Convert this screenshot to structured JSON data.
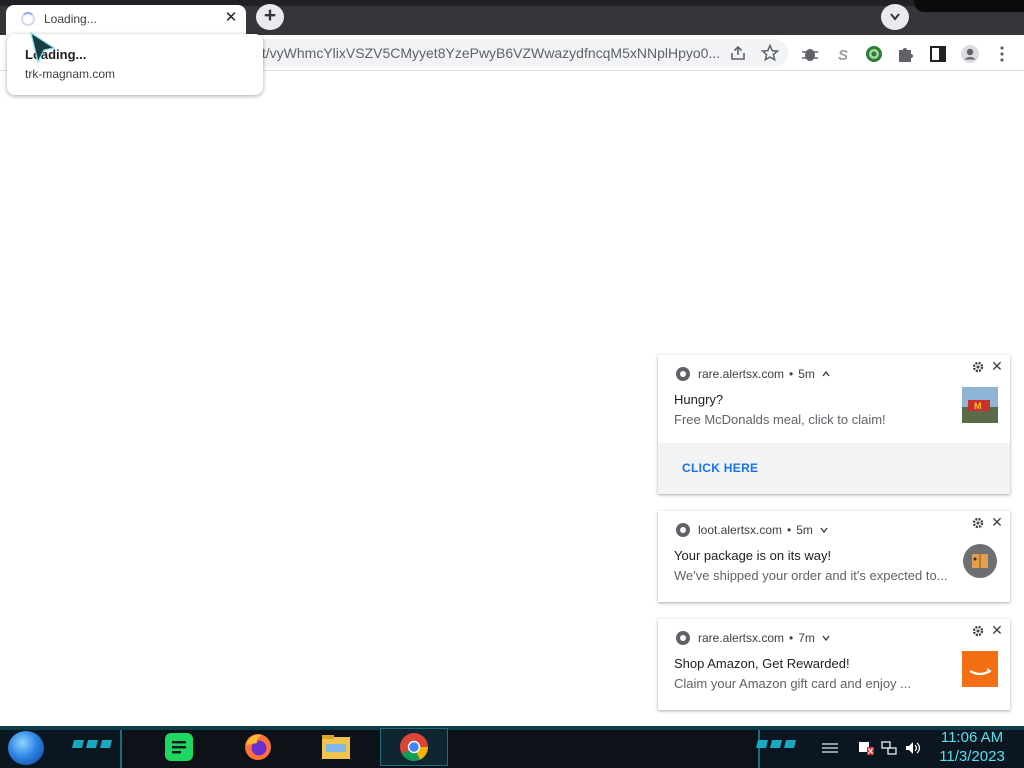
{
  "browser": {
    "tab": {
      "title": "Loading..."
    },
    "new_tab_label": "+",
    "tab_close_label": "✕",
    "url": "/t/vyWhmcYlixVSZV5CMyyet8YzePwyB6VZWwazydfncqM5xNNplHpyo0...",
    "hover_card": {
      "title": "Loading...",
      "domain": "trk-magnam.com"
    }
  },
  "notifications": [
    {
      "source": "rare.alertsx.com",
      "age": "5m",
      "expanded": true,
      "title": "Hungry?",
      "message": "Free McDonalds meal, click to claim!",
      "action": "CLICK HERE",
      "thumb_icon": "mcdonalds-storefront"
    },
    {
      "source": "loot.alertsx.com",
      "age": "5m",
      "expanded": false,
      "title": "Your package is on its way!",
      "message": "We've shipped your order and it's expected to...",
      "thumb_icon": "package-delivery"
    },
    {
      "source": "rare.alertsx.com",
      "age": "7m",
      "expanded": false,
      "title": "Shop Amazon, Get Rewarded!",
      "message": "Claim your Amazon gift card and enjoy ...",
      "thumb_icon": "amazon-logo"
    }
  ],
  "taskbar": {
    "time": "11:06 AM",
    "date": "11/3/2023",
    "apps": [
      "spotify",
      "firefox",
      "file-explorer",
      "chrome"
    ],
    "accent_color": "#56e0f0"
  }
}
